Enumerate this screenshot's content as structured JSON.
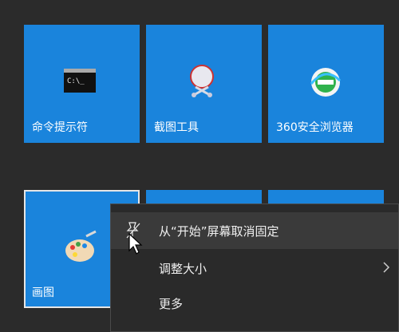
{
  "tiles": [
    {
      "label": "命令提示符",
      "icon": "cmd-icon"
    },
    {
      "label": "截图工具",
      "icon": "snipping-tool-icon"
    },
    {
      "label": "360安全浏览器",
      "icon": "360-browser-icon"
    },
    {
      "label": "画图",
      "icon": "paint-icon"
    }
  ],
  "context_menu": {
    "items": [
      {
        "label": "从“开始”屏幕取消固定",
        "icon": "unpin-icon"
      },
      {
        "label": "调整大小",
        "icon": "chevron-right-icon"
      },
      {
        "label": "更多"
      }
    ]
  },
  "colors": {
    "tile": "#1a84dc",
    "background": "#2b2b2b",
    "menu": "#2a2a2a",
    "menu_hover": "#3a3a3a"
  }
}
